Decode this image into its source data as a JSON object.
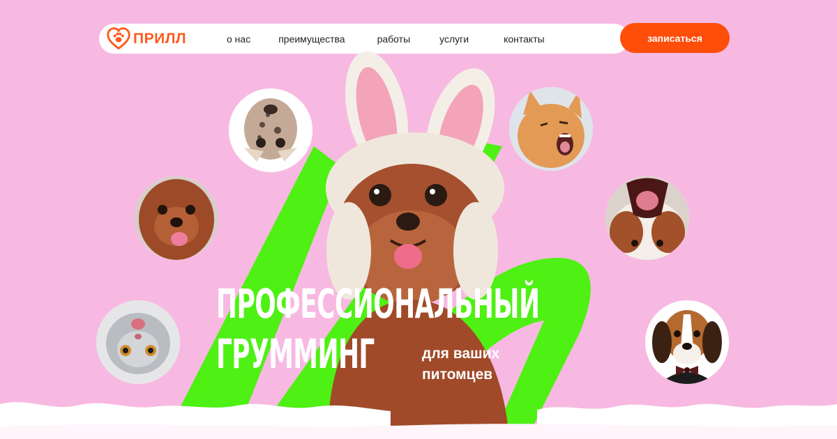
{
  "brand": {
    "name": "ПРИЛЛ",
    "logo_icon": "heart-paw-icon",
    "accent_color": "#ff4d0a"
  },
  "nav": {
    "items": [
      {
        "label": "о нас"
      },
      {
        "label": "преимущества"
      },
      {
        "label": "работы"
      },
      {
        "label": "услуги"
      },
      {
        "label": "контакты"
      }
    ],
    "cta_label": "записаться"
  },
  "hero": {
    "title_line1": "ПРОФЕССИОНАЛЬНЫЙ",
    "title_line2": "ГРУММИНГ",
    "subtitle": "для ваших питомцев",
    "background_color": "#f7b9e1",
    "swoosh_color": "#4ff014"
  },
  "pets": {
    "center": "poodle-with-bunny-ears",
    "circles": [
      {
        "name": "spotted-dog-upside-down"
      },
      {
        "name": "poodle-puppy"
      },
      {
        "name": "grey-cat-upside-down"
      },
      {
        "name": "ginger-cat-meowing"
      },
      {
        "name": "dog-yawning"
      },
      {
        "name": "beagle-with-bow-tie"
      }
    ]
  }
}
